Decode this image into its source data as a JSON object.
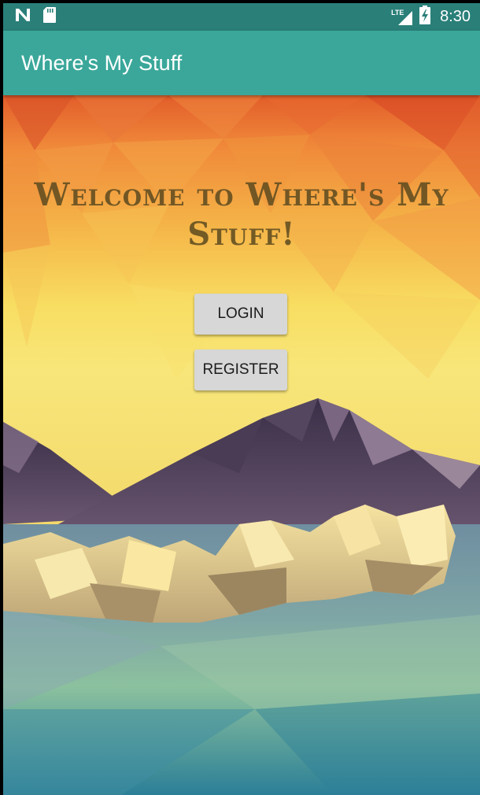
{
  "status_bar": {
    "time": "8:30",
    "network_label": "LTE",
    "icons": [
      "n-notification-icon",
      "sd-card-icon",
      "lte-signal-icon",
      "battery-charging-icon"
    ]
  },
  "app_bar": {
    "title": "Where's My Stuff"
  },
  "main": {
    "welcome_text": "Welcome to Where's My Stuff!",
    "login_label": "LOGIN",
    "register_label": "REGISTER"
  },
  "colors": {
    "status_bar": "#2a7f79",
    "app_bar": "#3aa79a",
    "button_bg": "#d7d7d7",
    "welcome_text": "#5c4a1f"
  }
}
